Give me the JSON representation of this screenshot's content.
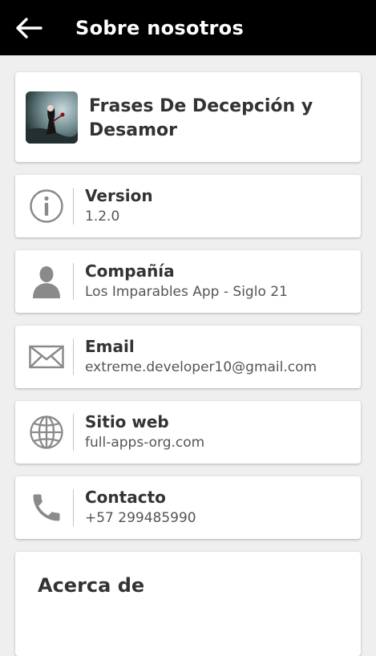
{
  "appbar": {
    "title": "Sobre nosotros"
  },
  "app": {
    "name": "Frases De Decepción y Desamor"
  },
  "items": [
    {
      "label": "Version",
      "value": "1.2.0",
      "icon": "info-icon"
    },
    {
      "label": "Compañía",
      "value": "Los Imparables App - Siglo 21",
      "icon": "person-icon"
    },
    {
      "label": "Email",
      "value": "extreme.developer10@gmail.com",
      "icon": "envelope-icon"
    },
    {
      "label": "Sitio web",
      "value": "full-apps-org.com",
      "icon": "globe-icon"
    },
    {
      "label": "Contacto",
      "value": "+57 299485990",
      "icon": "phone-icon"
    }
  ],
  "about": {
    "title": "Acerca de"
  },
  "colors": {
    "appbar": "#000000",
    "background": "#efefef",
    "icon_gray": "#8a8a8a"
  }
}
